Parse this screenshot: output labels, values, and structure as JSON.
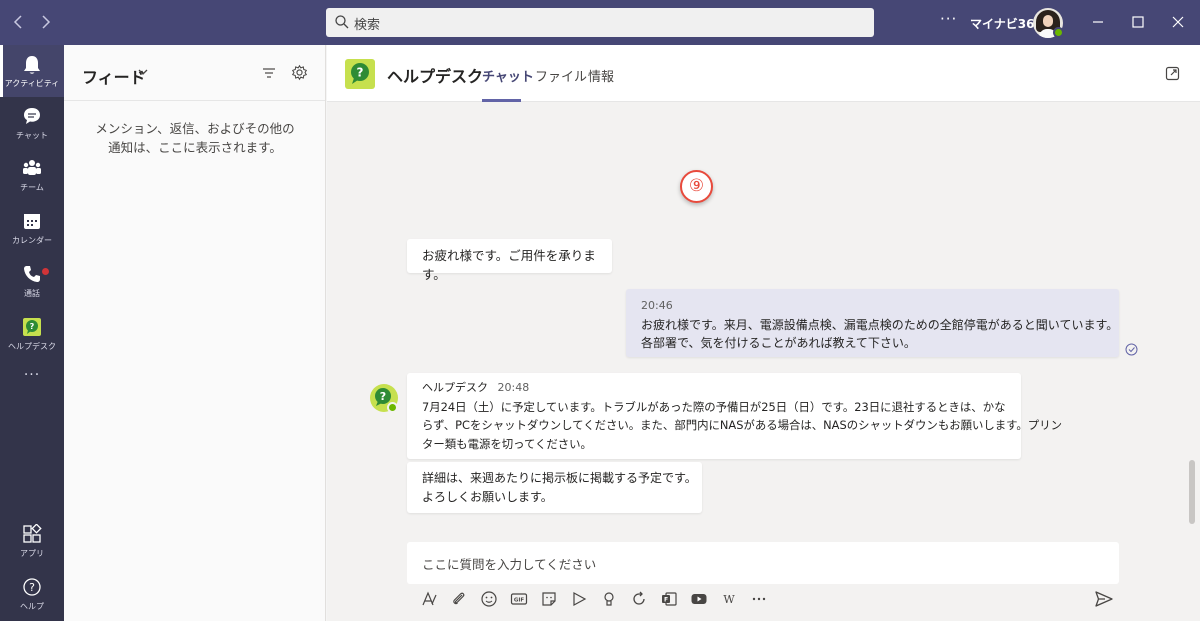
{
  "titlebar": {
    "search_placeholder": "検索",
    "more": "···",
    "org_name": "マイナビ365",
    "icons": [
      "back-arrow-icon",
      "forward-arrow-icon",
      "search-icon",
      "more-icon",
      "minimize-icon",
      "maximize-icon",
      "close-icon"
    ]
  },
  "rail": {
    "items": [
      {
        "label": "アクティビティ",
        "icon": "bell-icon",
        "active": true
      },
      {
        "label": "チャット",
        "icon": "chat-icon"
      },
      {
        "label": "チーム",
        "icon": "teams-icon"
      },
      {
        "label": "カレンダー",
        "icon": "calendar-icon"
      },
      {
        "label": "通話",
        "icon": "phone-icon",
        "badge": true
      },
      {
        "label": "ヘルプデスク",
        "icon": "helpdesk-app-icon"
      },
      {
        "label": "···",
        "icon": "more-icon"
      },
      {
        "label": "アプリ",
        "icon": "apps-icon"
      },
      {
        "label": "ヘルプ",
        "icon": "help-icon"
      }
    ]
  },
  "feed": {
    "title": "フィード",
    "empty_line1": "メンション、返信、およびその他の",
    "empty_line2": "通知は、ここに表示されます。"
  },
  "header": {
    "title": "ヘルプデスク",
    "tabs": [
      {
        "label": "チャット",
        "active": true
      },
      {
        "label": "ファイル"
      },
      {
        "label": "情報"
      }
    ]
  },
  "annotation": "⑨",
  "messages": {
    "greeting": "お疲れ様です。ご用件を承ります。",
    "mine": {
      "time": "20:46",
      "line1": "お疲れ様です。来月、電源設備点検、漏電点検のための全館停電があると聞いています。",
      "line2": "各部署で、気を付けることがあれば教えて下さい。"
    },
    "bot": {
      "author": "ヘルプデスク",
      "time": "20:48",
      "line1": "7月24日（土）に予定しています。トラブルがあった際の予備日が25日（日）です。23日に退社するときは、かな",
      "line2": "らず、PCをシャットダウンしてください。また、部門内にNASがある場合は、NASのシャットダウンもお願いします。プリン",
      "line3": "ター類も電源を切ってください。"
    },
    "followup": {
      "line1": "詳細は、来週あたりに掲示板に掲載する予定です。",
      "line2": "よろしくお願いします。"
    }
  },
  "compose": {
    "placeholder": "ここに質問を入力してください",
    "tools": [
      "format-icon",
      "attach-icon",
      "emoji-icon",
      "gif-icon",
      "sticker-icon",
      "meet-icon",
      "praise-icon",
      "loop-icon",
      "forms-icon",
      "youtube-icon",
      "wiki-icon",
      "more-options-icon",
      "send-icon"
    ]
  },
  "colors": {
    "titlebar": "#464775",
    "rail": "#33344a",
    "accent": "#6264a7",
    "presence": "#6bb700",
    "annotation": "#e84a3c"
  }
}
